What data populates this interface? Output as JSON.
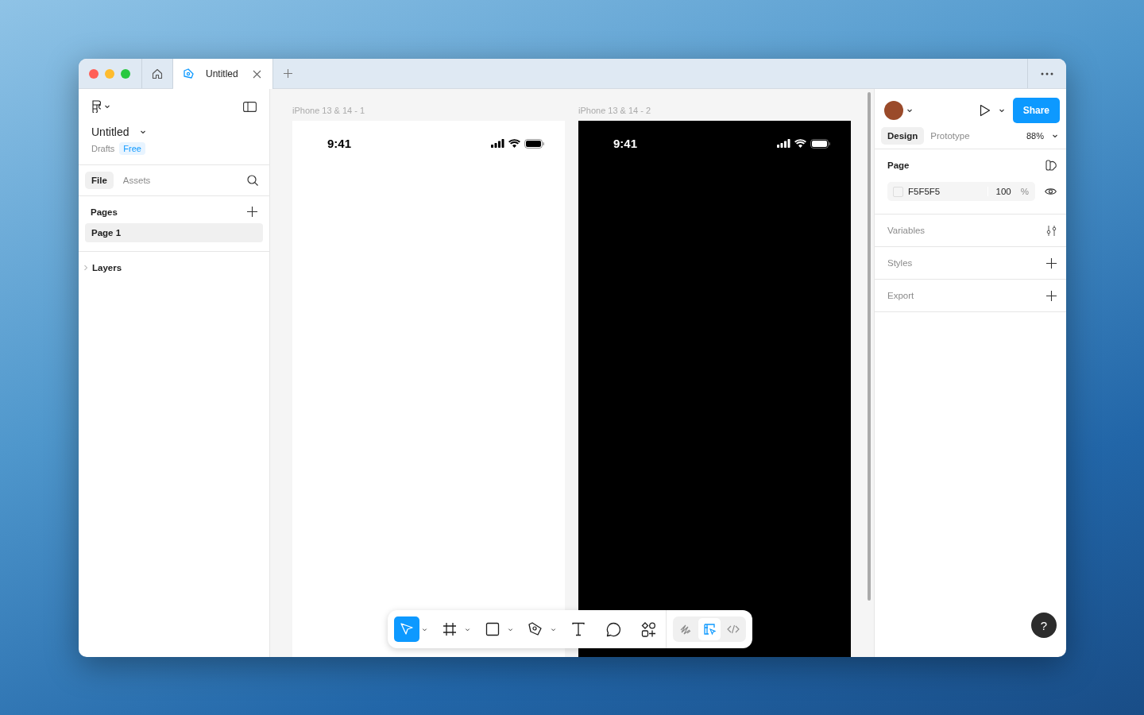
{
  "window_tabs": [
    {
      "kind": "home",
      "selected": false
    },
    {
      "kind": "file",
      "label": "Untitled",
      "selected": true
    }
  ],
  "left_panel": {
    "file_name": "Untitled",
    "location": "Drafts",
    "plan_badge": "Free",
    "tabs": [
      {
        "label": "File",
        "selected": true
      },
      {
        "label": "Assets",
        "selected": false
      }
    ],
    "pages_heading": "Pages",
    "pages": [
      {
        "label": "Page 1",
        "selected": true
      }
    ],
    "layers": {
      "label": "Layers",
      "expanded": false
    }
  },
  "canvas": {
    "frames": [
      {
        "label": "iPhone 13 & 14 - 1",
        "kind": "light",
        "time": "9:41"
      },
      {
        "label": "iPhone 13 & 14 - 2",
        "kind": "dark",
        "time": "9:41"
      }
    ],
    "toolbar": [
      {
        "kind": "move",
        "selected": true,
        "dropdown": true
      },
      {
        "kind": "frame",
        "selected": false,
        "dropdown": true
      },
      {
        "kind": "rectangle",
        "selected": false,
        "dropdown": true
      },
      {
        "kind": "pen",
        "selected": false,
        "dropdown": true
      },
      {
        "kind": "text",
        "selected": false,
        "dropdown": false
      },
      {
        "kind": "comment",
        "selected": false,
        "dropdown": false
      },
      {
        "kind": "components",
        "selected": false,
        "dropdown": false
      }
    ],
    "modes": [
      {
        "kind": "draw",
        "selected": false
      },
      {
        "kind": "design",
        "selected": true
      },
      {
        "kind": "dev",
        "selected": false
      }
    ]
  },
  "right_panel": {
    "share_button": "Share",
    "tabs": [
      {
        "label": "Design",
        "selected": true
      },
      {
        "label": "Prototype",
        "selected": false
      }
    ],
    "zoom": "88%",
    "page_section": {
      "title": "Page",
      "fill_hex": "F5F5F5",
      "opacity": "100",
      "opacity_unit": "%"
    },
    "sections": [
      {
        "title": "Variables",
        "kind": "variables"
      },
      {
        "title": "Styles",
        "kind": "add"
      },
      {
        "title": "Export",
        "kind": "add"
      }
    ],
    "help_button": "?"
  }
}
